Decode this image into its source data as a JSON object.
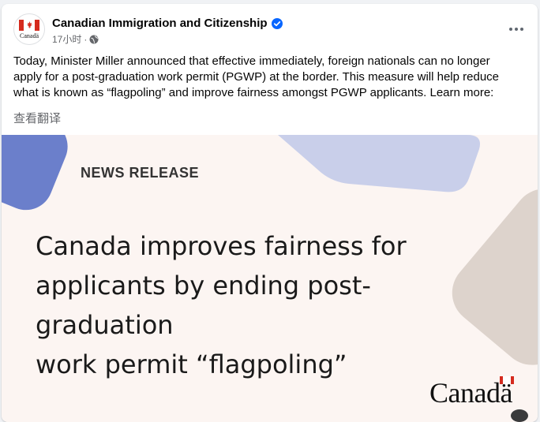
{
  "post": {
    "page_name": "Canadian Immigration and Citizenship",
    "timestamp": "17小时",
    "separator": "·",
    "avatar_wordmark": "Canadä",
    "text": "Today, Minister Miller announced that effective immediately, foreign nationals can no longer apply for a post-graduation work permit (PGWP) at the border. This measure will help reduce what is known as “flagpoling” and improve fairness amongst PGWP applicants. Learn more:",
    "translate_link": "查看翻译"
  },
  "image": {
    "label": "NEWS RELEASE",
    "headline_line1": "Canada improves fairness for",
    "headline_line2": "applicants by ending post-graduation",
    "headline_line3": "work permit “flagpoling”",
    "wordmark": "Canadä"
  },
  "colors": {
    "flag_red": "#d52b1e",
    "verified_blue": "#0866ff",
    "shape_blue": "#6b7fcb",
    "shape_lavender": "#c9cfea",
    "shape_taupe": "#ddd3cc",
    "hero_bg": "#fcf5f2"
  },
  "icons": {
    "verified": "verified-badge-icon",
    "audience": "globe-icon",
    "more": "more-options-icon"
  }
}
